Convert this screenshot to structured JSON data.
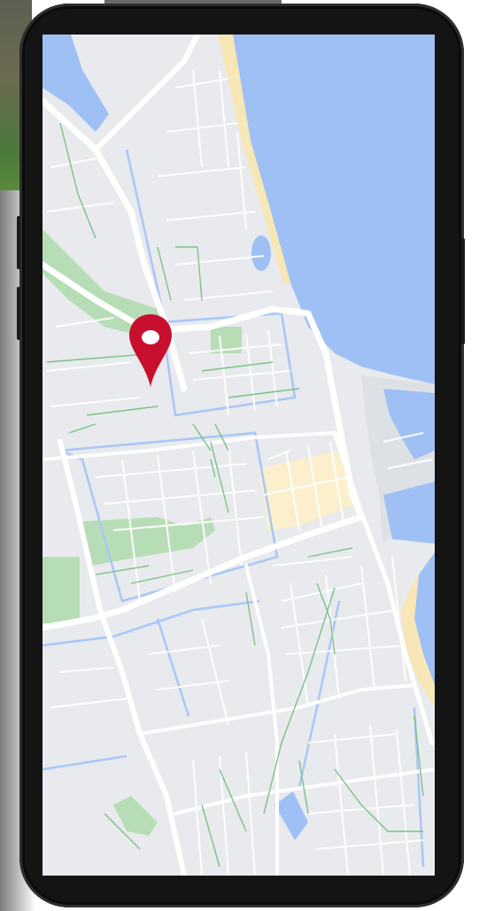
{
  "map": {
    "colors": {
      "land": "#e8eaed",
      "water": "#9ec0f5",
      "park": "#b7ddb6",
      "sand": "#f7e7b6",
      "road": "#ffffff",
      "path": "#7cc289",
      "canal": "#a8c7f7",
      "pin": "#c8102e"
    },
    "pin_icon": "location-pin-icon"
  }
}
